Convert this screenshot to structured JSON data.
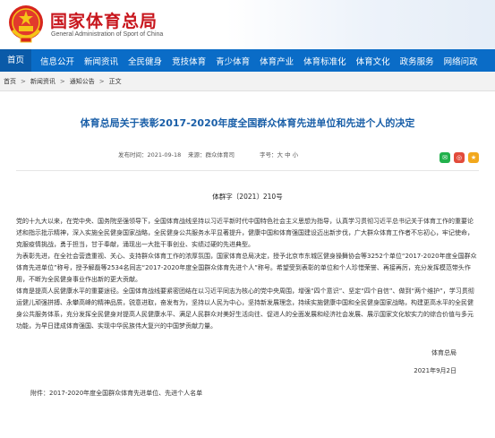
{
  "header": {
    "site_title": "国家体育总局",
    "site_subtitle": "General Administration of Sport of China"
  },
  "nav": {
    "items": [
      "首页",
      "信息公开",
      "新闻资讯",
      "全民健身",
      "竞技体育",
      "青少体育",
      "体育产业",
      "体育标准化",
      "体育文化",
      "政务服务",
      "网络问政"
    ]
  },
  "breadcrumb": {
    "items": [
      "首页",
      "新闻资讯",
      "通知公告",
      "正文"
    ],
    "separator": ">"
  },
  "article": {
    "title": "体育总局关于表彰2017-2020年度全国群众体育先进单位和先进个人的决定",
    "date_label": "发布时间：2021-09-18",
    "source_label": "来源：群众体育司",
    "font_label": "字号：大 中 小",
    "doc_number": "体群字〔2021〕210号",
    "paragraphs": [
      "党的十九大以来，在党中央、国务院坚强领导下，全国体育战线坚持以习近平新时代中国特色社会主义思想为指导，认真学习贯彻习近平总书记关于体育工作的重要论述和指示批示精神，深入实施全民健身国家战略，全民健身公共服务水平显著提升，健康中国和体育强国建设迈出新步伐，广大群众体育工作者不忘初心，牢记使命，克服疫情挑战，勇于担当，甘于奉献，涌现出一大批干事创业、实绩过硬的先进典型。",
      "为表彰先进，在全社会营造重视、关心、支持群众体育工作的浓厚氛围，国家体育总局决定，授予北京市东城区健身操舞协会等3252个单位“2017-2020年度全国群众体育先进单位”称号，授予解磊等2534名同志“2017-2020年度全国群众体育先进个人”称号。希望受到表彰的单位和个人珍惜荣誉、再接再厉，充分发挥模范带头作用，不断为全民健身事业作出新的更大贡献。",
      "体育是提高人民健康水平的重要途径。全国体育战线要紧密团结在以习近平同志为核心的党中央周围，增强“四个意识”、坚定“四个自信”、做到“两个维护”，学习贯彻运健儿顽强拼搏、永攀高峰的精神品质，锐意进取，奋发有为，坚持以人民为中心，坚持新发展理念，持续实施健康中国和全民健身国家战略，构建更高水平的全民健身公共服务体系，充分发挥全民健身对提高人民健康水平、满足人民群众对美好生活向往、促进人的全面发展和经济社会发展、展示国家文化软实力的综合价值与多元功能，为早日建成体育强国、实现中华民族伟大复兴的中国梦贡献力量。"
    ],
    "signature": "体育总局",
    "sign_date": "2021年9月2日",
    "attachment": "附件：2017-2020年度全国群众体育先进单位、先进个人名单"
  },
  "share": {
    "icons": [
      "wechat-icon",
      "weibo-icon",
      "favorite-icon"
    ]
  },
  "colors": {
    "nav_blue": "#0a6cc7",
    "title_red": "#c8161d",
    "article_title_blue": "#1a5fa8"
  }
}
